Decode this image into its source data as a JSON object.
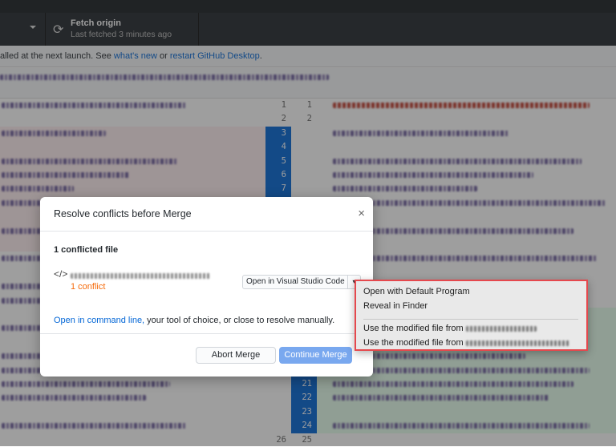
{
  "toolbar": {
    "fetch_title": "Fetch origin",
    "fetch_subtitle": "Last fetched 3 minutes ago"
  },
  "banner": {
    "text_prefix": "alled at the next launch. See ",
    "link1": "what's new",
    "text_mid": " or ",
    "link2": "restart GitHub Desktop",
    "text_suffix": "."
  },
  "diff": {
    "left_numbers_top": [
      "1",
      "2",
      "3",
      "4",
      "5",
      "6",
      "7"
    ],
    "right_numbers_top": [
      "1",
      "2"
    ],
    "right_numbers_bottom": [
      "21",
      "22",
      "23",
      "24",
      "25"
    ],
    "left_number_bottom": "26"
  },
  "dialog": {
    "title": "Resolve conflicts before Merge",
    "close": "×",
    "subtitle": "1 conflicted file",
    "conflict_count": "1 conflict",
    "open_button": "Open in Visual Studio Code",
    "cmd_link": "Open in command line,",
    "cmd_text": " your tool of choice, or close to resolve manually.",
    "abort": "Abort Merge",
    "continue": "Continue Merge"
  },
  "menu": {
    "items": [
      "Open with Default Program",
      "Reveal in Finder",
      "Use the modified file from",
      "Use the modified file from"
    ]
  },
  "colors": {
    "accent": "#0366d6",
    "conflict": "#f66a0a",
    "highlight_border": "#e5484d",
    "continue_bg": "#79a8ef"
  }
}
